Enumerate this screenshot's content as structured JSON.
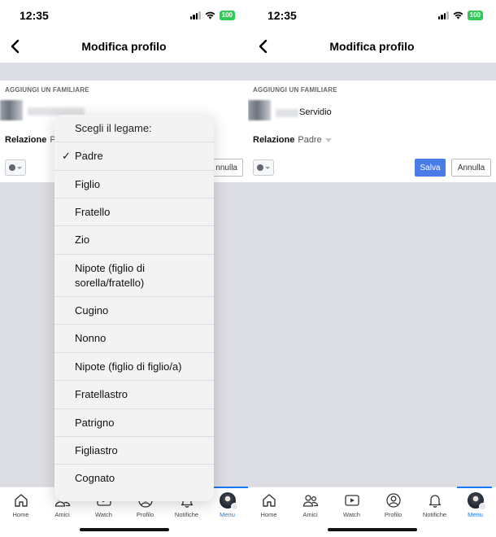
{
  "status": {
    "time": "12:35",
    "battery": "100"
  },
  "navbar": {
    "title": "Modifica profilo"
  },
  "form": {
    "section_title": "AGGIUNGI UN FAMILIARE",
    "relation_label": "Relazione",
    "relation_value_left": "P",
    "relation_value_right": "Padre",
    "name_suffix": "Servidio",
    "save_label": "Salva",
    "cancel_label": "Annulla",
    "cancel_label_partial": "nnulla"
  },
  "picker": {
    "title": "Scegli il legame:",
    "selected": "Padre",
    "check": "✓",
    "options": [
      "Padre",
      "Figlio",
      "Fratello",
      "Zio",
      "Nipote (figlio di sorella/fratello)",
      "Cugino",
      "Nonno",
      "Nipote (figlio di figlio/a)",
      "Fratellastro",
      "Patrigno",
      "Figliastro",
      "Cognato"
    ]
  },
  "tabbar": {
    "items": [
      {
        "label": "Home",
        "icon": "home-icon"
      },
      {
        "label": "Amici",
        "icon": "friends-icon"
      },
      {
        "label": "Watch",
        "icon": "watch-icon"
      },
      {
        "label": "Profilo",
        "icon": "profile-icon"
      },
      {
        "label": "Notifiche",
        "icon": "bell-icon"
      },
      {
        "label": "Menu",
        "icon": "avatar-icon"
      }
    ],
    "active": "Menu",
    "accent": "#1877f2"
  },
  "colors": {
    "save_button": "#4a7ce8",
    "battery": "#34c759",
    "content_bg": "#dcdde2"
  }
}
